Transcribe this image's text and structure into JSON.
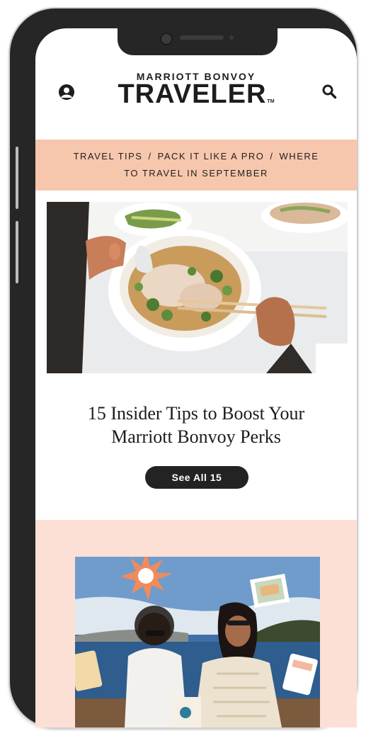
{
  "header": {
    "brand_top": "MARRIOTT BONVOY",
    "brand_main": "TRAVELER",
    "brand_tm": "TM",
    "account_icon": "account-circle-icon",
    "search_icon": "search-icon"
  },
  "breadcrumb": {
    "items": [
      "TRAVEL TIPS",
      "PACK IT LIKE A PRO",
      "WHERE TO TRAVEL IN SEPTEMBER"
    ],
    "separator": "/",
    "line2": "TO TRAVEL IN SEPTEMBER"
  },
  "article": {
    "title_line1": "15 Insider Tips to Boost Your",
    "title_line2": "Marriott Bonvoy Perks",
    "button_label": "See All 15"
  },
  "colors": {
    "frame": "#262626",
    "breadcrumb_bg": "#f7c7ad",
    "promo_bg": "#fde0d5",
    "button_bg": "#232323"
  }
}
